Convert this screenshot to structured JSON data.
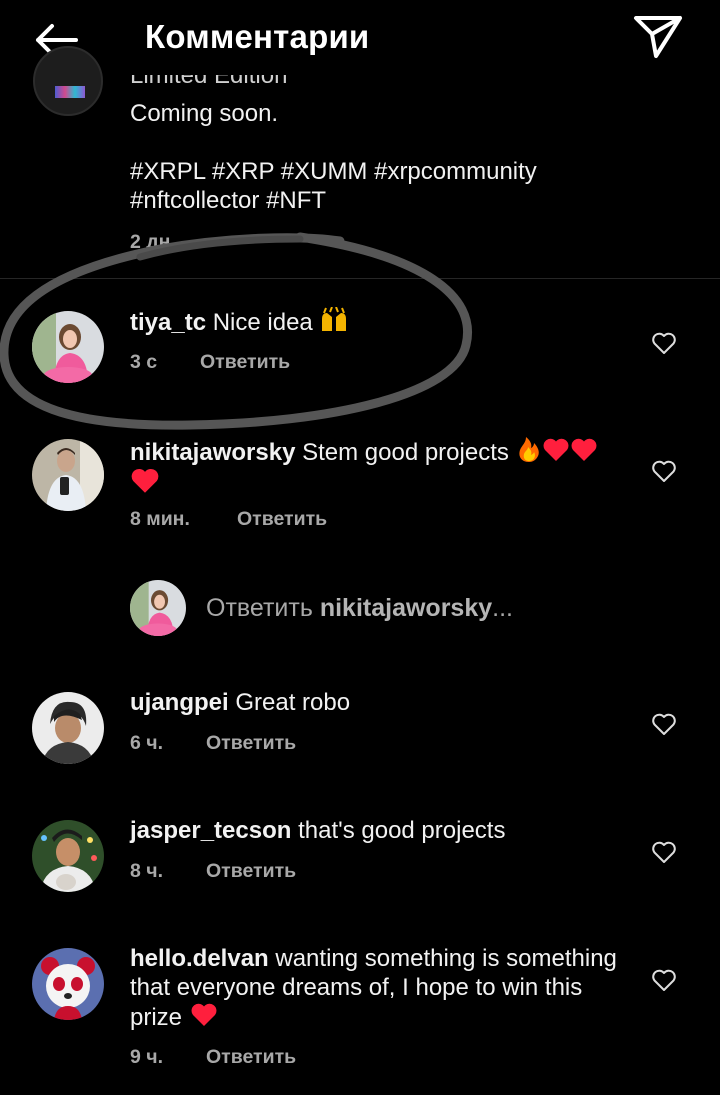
{
  "header": {
    "title": "Комментарии"
  },
  "caption": {
    "partial_line": "Limited Edition",
    "line1": "Coming soon.",
    "hashtags1": "#XRPL #XRP #XUMM #xrpcommunity",
    "hashtags2": "#nftcollector #NFT",
    "time": "2 дн."
  },
  "comments": [
    {
      "username": "tiya_tc",
      "text": "Nice idea",
      "time": "3 с",
      "reply": "Ответить",
      "emoji": "raising-hands"
    },
    {
      "username": "nikitajaworsky",
      "text": "Stem good projects",
      "time": "8 мин.",
      "reply": "Ответить",
      "emoji": "fire-hearts"
    },
    {
      "username": "ujangpei",
      "text": "Great robo",
      "time": "6 ч.",
      "reply": "Ответить"
    },
    {
      "username": "jasper_tecson",
      "text": "that's good projects",
      "time": "8 ч.",
      "reply": "Ответить"
    },
    {
      "username": "hello.delvan",
      "text": "wanting something is something that everyone dreams of, I hope to win this prize",
      "time": "9 ч.",
      "reply": "Ответить",
      "emoji": "heart"
    }
  ],
  "reply_prompt": {
    "prefix": "Ответить",
    "username": "nikitajaworsky",
    "suffix": "..."
  },
  "colors": {
    "background": "#000000",
    "secondary_text": "#a8a8a8",
    "heart_emoji": "#ff1f3d"
  }
}
